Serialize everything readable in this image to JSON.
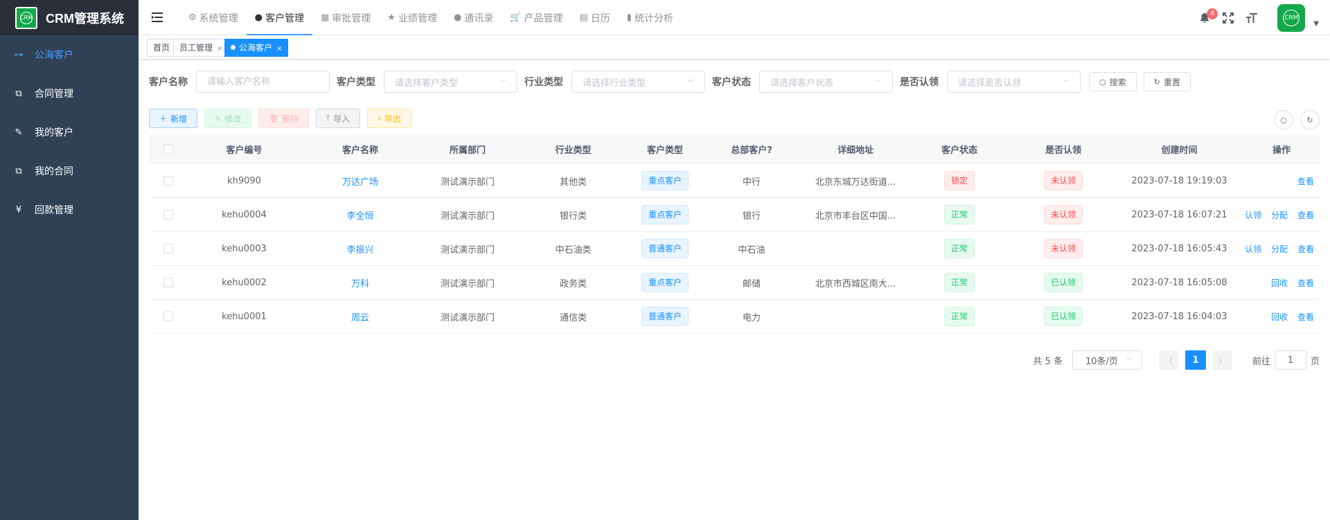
{
  "app": {
    "title": "CRM管理系统",
    "logo_text": "CRM"
  },
  "sidebar": {
    "items": [
      {
        "label": "公海客户",
        "icon": "tree-icon",
        "active": true
      },
      {
        "label": "合同管理",
        "icon": "copy-icon",
        "active": false
      },
      {
        "label": "我的客户",
        "icon": "edit-icon",
        "active": false
      },
      {
        "label": "我的合同",
        "icon": "copy-icon",
        "active": false
      },
      {
        "label": "回款管理",
        "icon": "yen-icon",
        "active": false
      }
    ]
  },
  "topnav": {
    "items": [
      {
        "label": "系统管理",
        "icon": "gear-icon"
      },
      {
        "label": "客户管理",
        "icon": "user-icon",
        "active": true
      },
      {
        "label": "审批管理",
        "icon": "table-icon"
      },
      {
        "label": "业绩管理",
        "icon": "star-icon"
      },
      {
        "label": "通讯录",
        "icon": "user-icon"
      },
      {
        "label": "产品管理",
        "icon": "cart-icon"
      },
      {
        "label": "日历",
        "icon": "calendar-icon"
      },
      {
        "label": "统计分析",
        "icon": "chart-icon"
      }
    ]
  },
  "header": {
    "notification_count": "4",
    "avatar_text": "CRM"
  },
  "tags": {
    "items": [
      {
        "label": "首页"
      },
      {
        "label": "员工管理"
      },
      {
        "label": "公海客户",
        "active": true
      }
    ],
    "close": "×"
  },
  "search": {
    "customer_name_label": "客户名称",
    "customer_name_placeholder": "请输入客户名称",
    "customer_type_label": "客户类型",
    "customer_type_placeholder": "请选择客户类型",
    "industry_label": "行业类型",
    "industry_placeholder": "请选择行业类型",
    "status_label": "客户状态",
    "status_placeholder": "请选择客户状态",
    "claimed_label": "是否认领",
    "claimed_placeholder": "请选择是否认领",
    "search_button": "搜索",
    "reset_button": "重置"
  },
  "toolbar": {
    "add": "新增",
    "edit": "修改",
    "delete": "删除",
    "import": "导入",
    "export": "导出"
  },
  "table": {
    "columns": [
      "客户编号",
      "客户名称",
      "所属部门",
      "行业类型",
      "客户类型",
      "总部客户?",
      "详细地址",
      "客户状态",
      "是否认领",
      "创建时间",
      "操作"
    ],
    "rows": [
      {
        "code": "kh9090",
        "name": "万达广场",
        "dept": "测试演示部门",
        "industry": "其他类",
        "type": "重点客户",
        "type_style": "primary",
        "hq": "中行",
        "address": "北京东城万达街道...",
        "status": "锁定",
        "status_style": "danger",
        "claimed": "未认领",
        "claimed_style": "danger",
        "created": "2023-07-18 19:19:03",
        "ops": [
          "查看"
        ]
      },
      {
        "code": "kehu0004",
        "name": "李全恒",
        "dept": "测试演示部门",
        "industry": "银行类",
        "type": "重点客户",
        "type_style": "primary",
        "hq": "银行",
        "address": "北京市丰台区中国...",
        "status": "正常",
        "status_style": "success",
        "claimed": "未认领",
        "claimed_style": "danger",
        "created": "2023-07-18 16:07:21",
        "ops": [
          "认领",
          "分配",
          "查看"
        ]
      },
      {
        "code": "kehu0003",
        "name": "李振兴",
        "dept": "测试演示部门",
        "industry": "中石油类",
        "type": "普通客户",
        "type_style": "primary",
        "hq": "中石油",
        "address": "",
        "status": "正常",
        "status_style": "success",
        "claimed": "未认领",
        "claimed_style": "danger",
        "created": "2023-07-18 16:05:43",
        "ops": [
          "认领",
          "分配",
          "查看"
        ]
      },
      {
        "code": "kehu0002",
        "name": "万科",
        "dept": "测试演示部门",
        "industry": "政务类",
        "type": "重点客户",
        "type_style": "primary",
        "hq": "邮储",
        "address": "北京市西城区南大...",
        "status": "正常",
        "status_style": "success",
        "claimed": "已认领",
        "claimed_style": "success",
        "created": "2023-07-18 16:05:08",
        "ops": [
          "回收",
          "查看"
        ]
      },
      {
        "code": "kehu0001",
        "name": "周云",
        "dept": "测试演示部门",
        "industry": "通信类",
        "type": "普通客户",
        "type_style": "primary",
        "hq": "电力",
        "address": "",
        "status": "正常",
        "status_style": "success",
        "claimed": "已认领",
        "claimed_style": "success",
        "created": "2023-07-18 16:04:03",
        "ops": [
          "回收",
          "查看"
        ]
      }
    ]
  },
  "pagination": {
    "total": "共 5 条",
    "page_size": "10条/页",
    "current_page": "1",
    "goto_prefix": "前往",
    "goto_value": "1",
    "goto_suffix": "页"
  },
  "colors": {
    "sidebar_bg": "#304156",
    "accent": "#1890ff",
    "logo_green": "#13a84a"
  }
}
